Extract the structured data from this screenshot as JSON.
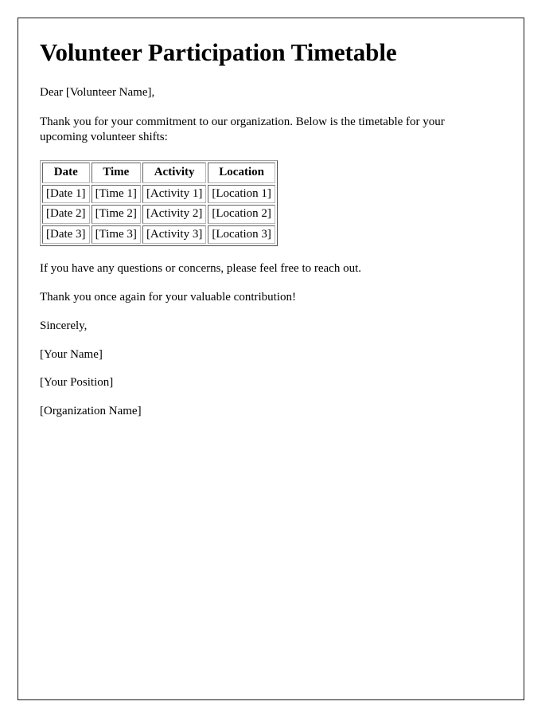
{
  "document": {
    "title": "Volunteer Participation Timetable",
    "salutation": "Dear [Volunteer Name],",
    "intro_paragraph": "Thank you for your commitment to our organization. Below is the timetable for your upcoming volunteer shifts:",
    "closing_paragraph_1": "If you have any questions or concerns, please feel free to reach out.",
    "closing_paragraph_2": "Thank you once again for your valuable contribution!",
    "signoff": "Sincerely,",
    "signature": {
      "name": "[Your Name]",
      "position": "[Your Position]",
      "organization": "[Organization Name]"
    }
  },
  "timetable": {
    "headers": [
      "Date",
      "Time",
      "Activity",
      "Location"
    ],
    "rows": [
      [
        "[Date 1]",
        "[Time 1]",
        "[Activity 1]",
        "[Location 1]"
      ],
      [
        "[Date 2]",
        "[Time 2]",
        "[Activity 2]",
        "[Location 2]"
      ],
      [
        "[Date 3]",
        "[Time 3]",
        "[Activity 3]",
        "[Location 3]"
      ]
    ]
  },
  "colors": {
    "text": "#000000",
    "page_border": "#1a1a1a",
    "table_border": "#a0a0a0",
    "cell_border": "#b8b8b8",
    "background": "#ffffff"
  }
}
